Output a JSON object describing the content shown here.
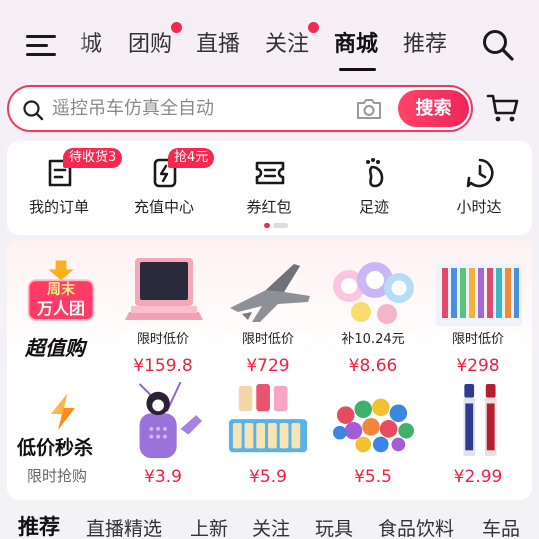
{
  "nav": {
    "tabs": [
      {
        "label": "城",
        "dot": false
      },
      {
        "label": "团购",
        "dot": true
      },
      {
        "label": "直播",
        "dot": false
      },
      {
        "label": "关注",
        "dot": true
      },
      {
        "label": "商城",
        "dot": false,
        "active": true
      },
      {
        "label": "推荐",
        "dot": false
      }
    ],
    "icons": [
      "menu-icon",
      "search-icon"
    ],
    "notification_color": "#f5284f"
  },
  "search": {
    "placeholder": "遥控吊车仿真全自动",
    "button_label": "搜索",
    "accent": "#f03a5a",
    "icons": [
      "magnifier-icon",
      "camera-icon",
      "cart-icon"
    ]
  },
  "quick_entries": [
    {
      "label": "我的订单",
      "badge": "待收货3",
      "icon": "order-icon"
    },
    {
      "label": "充值中心",
      "badge": "抢4元",
      "icon": "recharge-icon"
    },
    {
      "label": "券红包",
      "badge": "",
      "icon": "coupon-icon"
    },
    {
      "label": "足迹",
      "badge": "",
      "icon": "footprint-icon"
    },
    {
      "label": "小时达",
      "badge": "",
      "icon": "clock-icon"
    }
  ],
  "promo_rows": [
    {
      "banner_badge_line1": "周末",
      "banner_badge_line2": "万人团",
      "title": "超值购",
      "subtitle": "",
      "products": [
        {
          "tag": "限时低价",
          "price": "¥159.8",
          "icon": "laptop-image"
        },
        {
          "tag": "限时低价",
          "price": "¥729",
          "icon": "fighter-jet-image"
        },
        {
          "tag": "补10.24元",
          "price": "¥8.66",
          "icon": "balloon-toys-image"
        },
        {
          "tag": "限时低价",
          "price": "¥298",
          "icon": "toothbrush-set-image"
        }
      ]
    },
    {
      "banner_badge_line1": "",
      "banner_badge_line2": "",
      "title": "低价秒杀",
      "subtitle": "限时抢购",
      "products": [
        {
          "tag": "",
          "price": "¥3.9",
          "icon": "kuromi-toy-image"
        },
        {
          "tag": "",
          "price": "¥5.9",
          "icon": "yogurt-drinks-image"
        },
        {
          "tag": "",
          "price": "¥5.5",
          "icon": "colorful-balls-image"
        },
        {
          "tag": "",
          "price": "¥2.99",
          "icon": "lipstick-image"
        }
      ]
    }
  ],
  "bottom_tabs": [
    "推荐",
    "直播精选",
    "上新",
    "关注",
    "玩具",
    "食品饮料",
    "车品"
  ],
  "price_color": "#f02040"
}
